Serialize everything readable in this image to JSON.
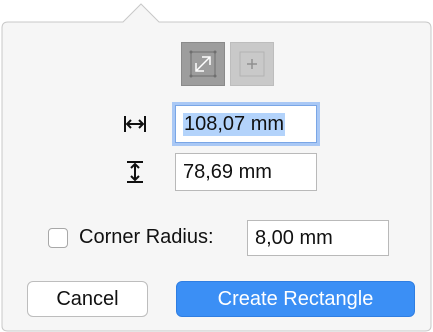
{
  "mode_buttons": [
    {
      "icon": "resize-diagonal-icon",
      "state": "selected"
    },
    {
      "icon": "plus-icon",
      "state": "disabled"
    }
  ],
  "width_field": {
    "icon": "width-arrows-icon",
    "value": "108,07 mm"
  },
  "height_field": {
    "icon": "height-arrows-icon",
    "value": "78,69 mm"
  },
  "corner_radius": {
    "label": "Corner Radius:",
    "checked": false,
    "value": "8,00 mm"
  },
  "buttons": {
    "cancel": "Cancel",
    "create": "Create Rectangle"
  },
  "colors": {
    "accent": "#3b8ff5",
    "focus_ring": "#a9c8f5",
    "popover_bg": "#f6f6f6"
  }
}
